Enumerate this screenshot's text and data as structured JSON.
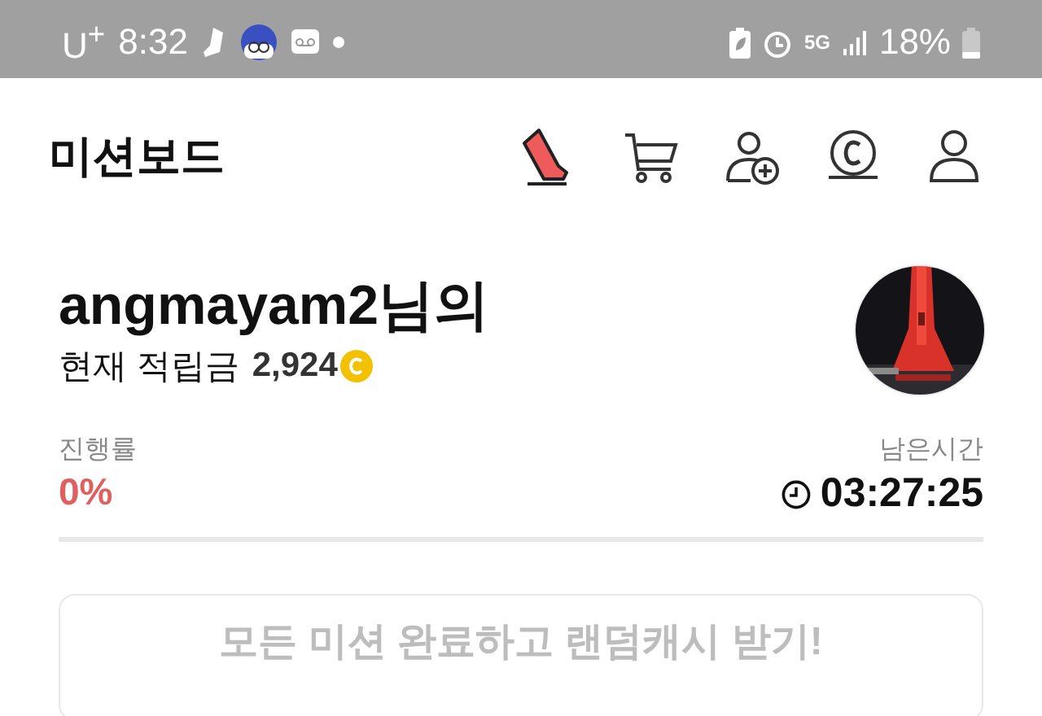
{
  "status_bar": {
    "carrier": "U$^{+}$",
    "time": "8:32",
    "network": "5G",
    "battery": "18%"
  },
  "header": {
    "title": "미션보드"
  },
  "user": {
    "name": "angmayam2님의",
    "balance_label": "현재 적립금",
    "balance": "2,924"
  },
  "progress": {
    "label": "진행률",
    "value": "0%",
    "level": 0
  },
  "remaining": {
    "label": "남은시간",
    "value": "03:27:25"
  },
  "reward_button": {
    "label": "모든 미션 완료하고 랜덤캐시 받기!",
    "disabled": true
  }
}
